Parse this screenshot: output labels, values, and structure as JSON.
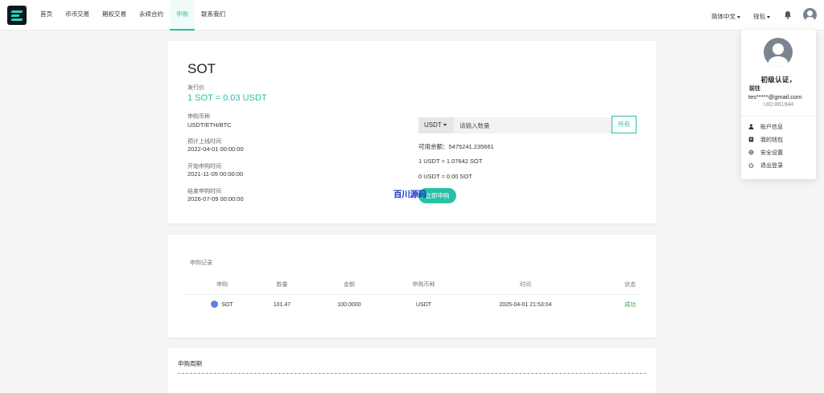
{
  "nav": {
    "items": [
      {
        "label": "首页"
      },
      {
        "label": "币币交易"
      },
      {
        "label": "期权交易"
      },
      {
        "label": "永续合约"
      },
      {
        "label": "申购",
        "active": true
      },
      {
        "label": "联系我们"
      }
    ],
    "language": "简体中文",
    "wallet": "钱包",
    "accent_color": "#27c0a6"
  },
  "subscription": {
    "coin": "SOT",
    "issue_price_label": "发行价",
    "issue_price": "1 SOT = 0.03 USDT",
    "currency_label": "申购币种",
    "currency_value": "USDT/ETH/BTC",
    "launch_label": "预计上线时间",
    "launch_value": "2022-04-01 00:00:00",
    "start_label": "开始申购时间",
    "start_value": "2021-11-05 00:00:00",
    "end_label": "结束申购时间",
    "end_value": "2026-07-09 00:00:00",
    "selected_currency": "USDT",
    "amount_placeholder": "请输入数量",
    "all_button": "所有",
    "balance_line": "可用余额：5475241.235661",
    "rate_line": "1 USDT ≈ 1.07642 SOT",
    "estimate_line": "0 USDT ≈ 0.00 SOT",
    "buy_button": "立即申购",
    "watermark": "百川源码"
  },
  "records": {
    "title": "申购记录",
    "columns": [
      "申购",
      "数量",
      "金额",
      "申购币种",
      "时间",
      "状态"
    ],
    "rows": [
      {
        "coin": "SOT",
        "quantity": "101.47",
        "amount": "100.0000",
        "currency": "USDT",
        "time": "2025-04-01 21:53:04",
        "status": "成功"
      }
    ],
    "success_color": "#38a149"
  },
  "period": {
    "title": "申购周期"
  },
  "user_menu": {
    "verify_status": "初级认证，",
    "goto": "前往",
    "email": "tes*****@gmail.com",
    "uid": "UID:861944",
    "items": [
      {
        "label": "账户信息",
        "icon": "user-icon"
      },
      {
        "label": "我的钱包",
        "icon": "wallet-icon"
      },
      {
        "label": "安全设置",
        "icon": "gear-icon"
      },
      {
        "label": "退出登录",
        "icon": "power-icon"
      }
    ]
  }
}
